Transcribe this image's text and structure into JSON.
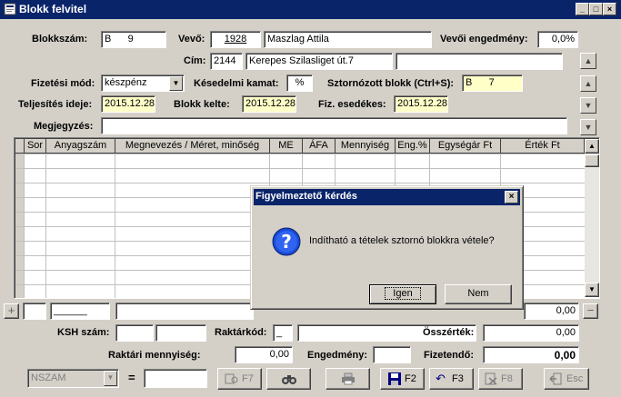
{
  "window": {
    "title": "Blokk felvitel",
    "controls": [
      "_",
      "□",
      "×"
    ]
  },
  "form": {
    "blokkszam_label": "Blokkszám:",
    "blokkszam_value": "B      9",
    "vevo_label": "Vevő:",
    "vevo_code": "1928",
    "vevo_name": "Maszlag Attila",
    "vevoi_engedmeny_label": "Vevői engedmény:",
    "vevoi_engedmeny_value": "0,0%",
    "cim_label": "Cím:",
    "cim_zip": "2144",
    "cim_street": "Kerepes Szilasliget út.7",
    "cim_extra": "",
    "fizetesi_mod_label": "Fizetési mód:",
    "fizetesi_mod_value": "készpénz",
    "kesedelmi_kamat_label": "Késedelmi kamat:",
    "kesedelmi_kamat_value": "%",
    "sztornozott_label": "Sztornózott blokk (Ctrl+S):",
    "sztornozott_value": "B      7",
    "teljesites_label": "Teljesítés ideje:",
    "teljesites_value": "2015.12.28",
    "blokk_kelte_label": "Blokk kelte:",
    "blokk_kelte_value": "2015.12.28",
    "fiz_esedekes_label": "Fiz. esedékes:",
    "fiz_esedekes_value": "2015.12.28",
    "megjegyzes_label": "Megjegyzés:",
    "megjegyzes_value": ""
  },
  "grid": {
    "columns": [
      "Sor",
      "Anyagszám",
      "Megnevezés / Méret, minőség",
      "ME",
      "ÁFA",
      "Mennyiség",
      "Eng.%",
      "Egységár Ft",
      "Érték Ft"
    ],
    "rows": []
  },
  "entry_row": {
    "anyagszam": "______",
    "value": "0,00"
  },
  "bottom": {
    "ksh_label": "KSH szám:",
    "raktarkod_label": "Raktárkód:",
    "raktarkod_value": "_",
    "osszertek_label": "Összérték:",
    "osszertek_value": "0,00",
    "raktari_menny_label": "Raktári mennyiség:",
    "raktari_menny_value": "0,00",
    "engedmeny_label": "Engedmény:",
    "engedmeny_value": "",
    "fizetendo_label": "Fizetendő:",
    "fizetendo_value": "0,00"
  },
  "toolbar": {
    "nszam_value": "NSZAM",
    "equals": "=",
    "search_value": "",
    "f7_label": "F7",
    "f2_label": "F2",
    "f3_label": "F3",
    "f8_label": "F8",
    "esc_label": "Esc"
  },
  "dialog": {
    "title": "Figyelmeztető kérdés",
    "message": "Indítható a tételek sztornó blokkra vétele?",
    "yes_label": "Igen",
    "no_label": "Nem"
  },
  "colors": {
    "titlebar": "#0a246a",
    "face": "#d4d0c8",
    "date_field": "#ffffc8"
  }
}
